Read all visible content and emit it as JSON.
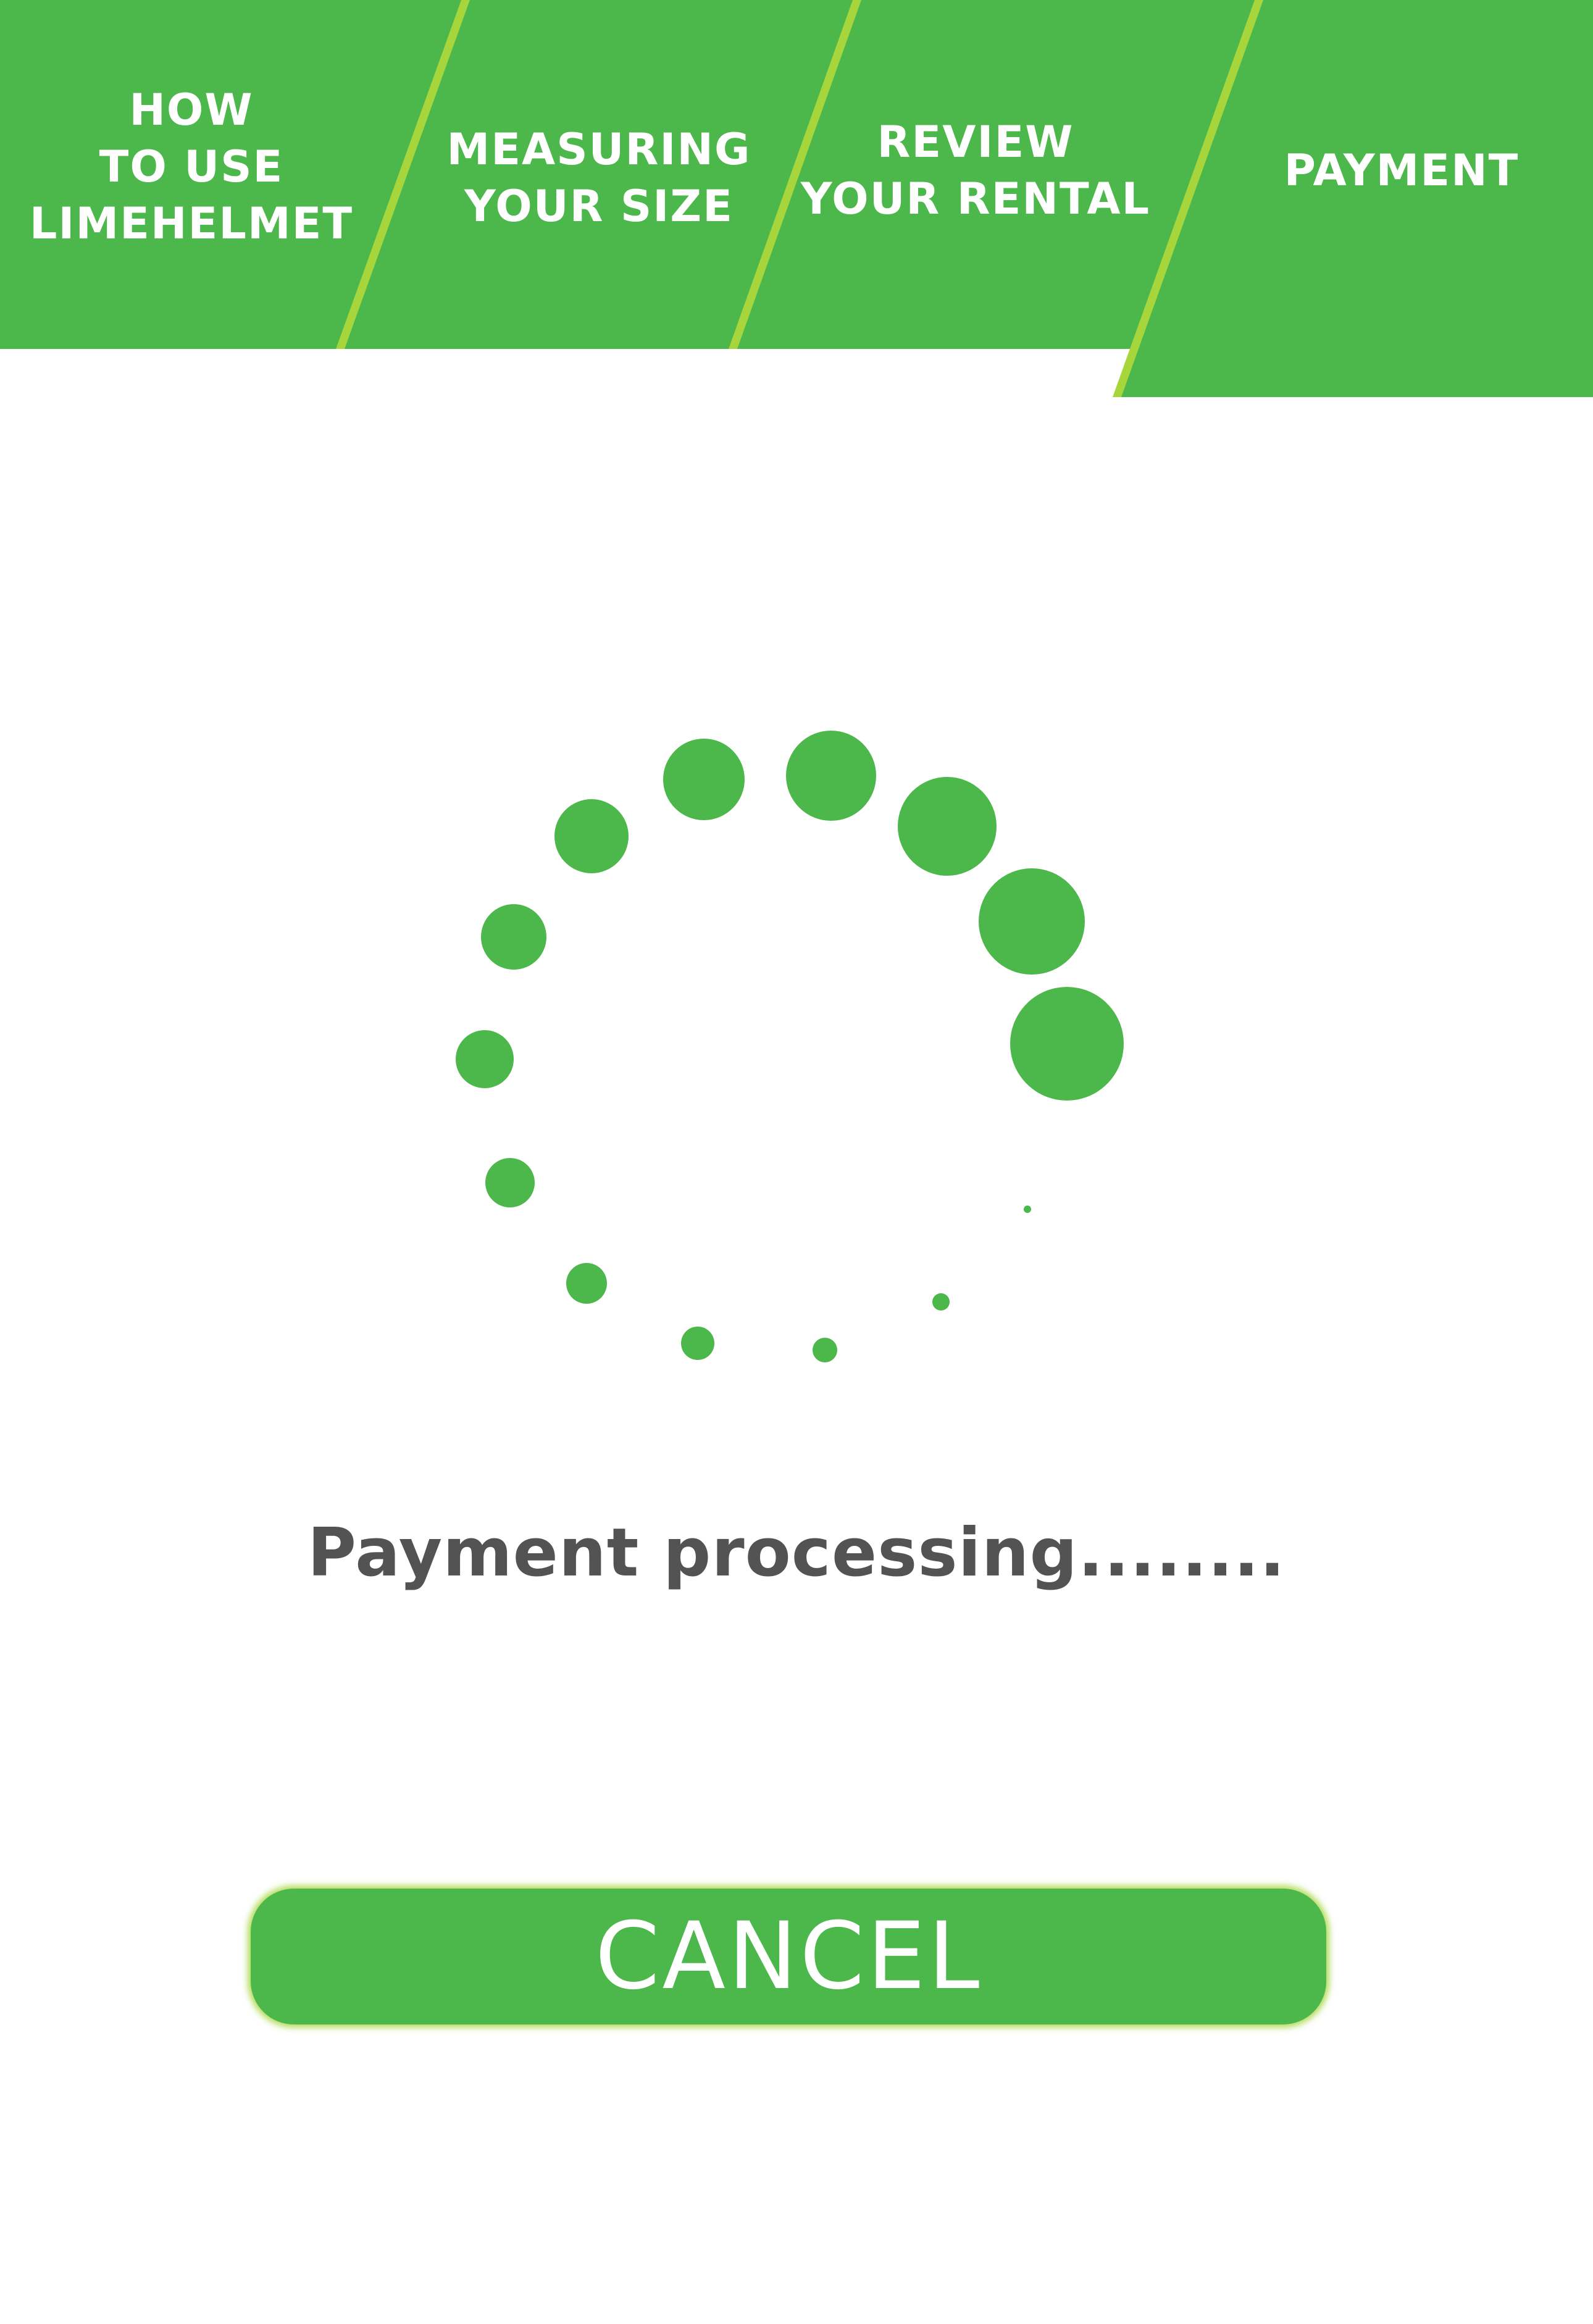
{
  "colors": {
    "brand_green": "#4cb74a",
    "separator_lime": "#a6d63c",
    "text_dark": "#535353",
    "background": "#ffffff"
  },
  "steps": [
    {
      "lines": [
        "HOW",
        "TO USE",
        "LIMEHELMET"
      ],
      "active": false
    },
    {
      "lines": [
        "MEASURING",
        "YOUR SIZE"
      ],
      "active": false
    },
    {
      "lines": [
        "REVIEW",
        "YOUR RENTAL"
      ],
      "active": false
    },
    {
      "lines": [
        "PAYMENT"
      ],
      "active": true
    }
  ],
  "spinner": {
    "icon": "loading-spinner-icon",
    "dot_count": 16
  },
  "status": {
    "text": "Payment processing........"
  },
  "cancel_button": {
    "label": "CANCEL"
  }
}
